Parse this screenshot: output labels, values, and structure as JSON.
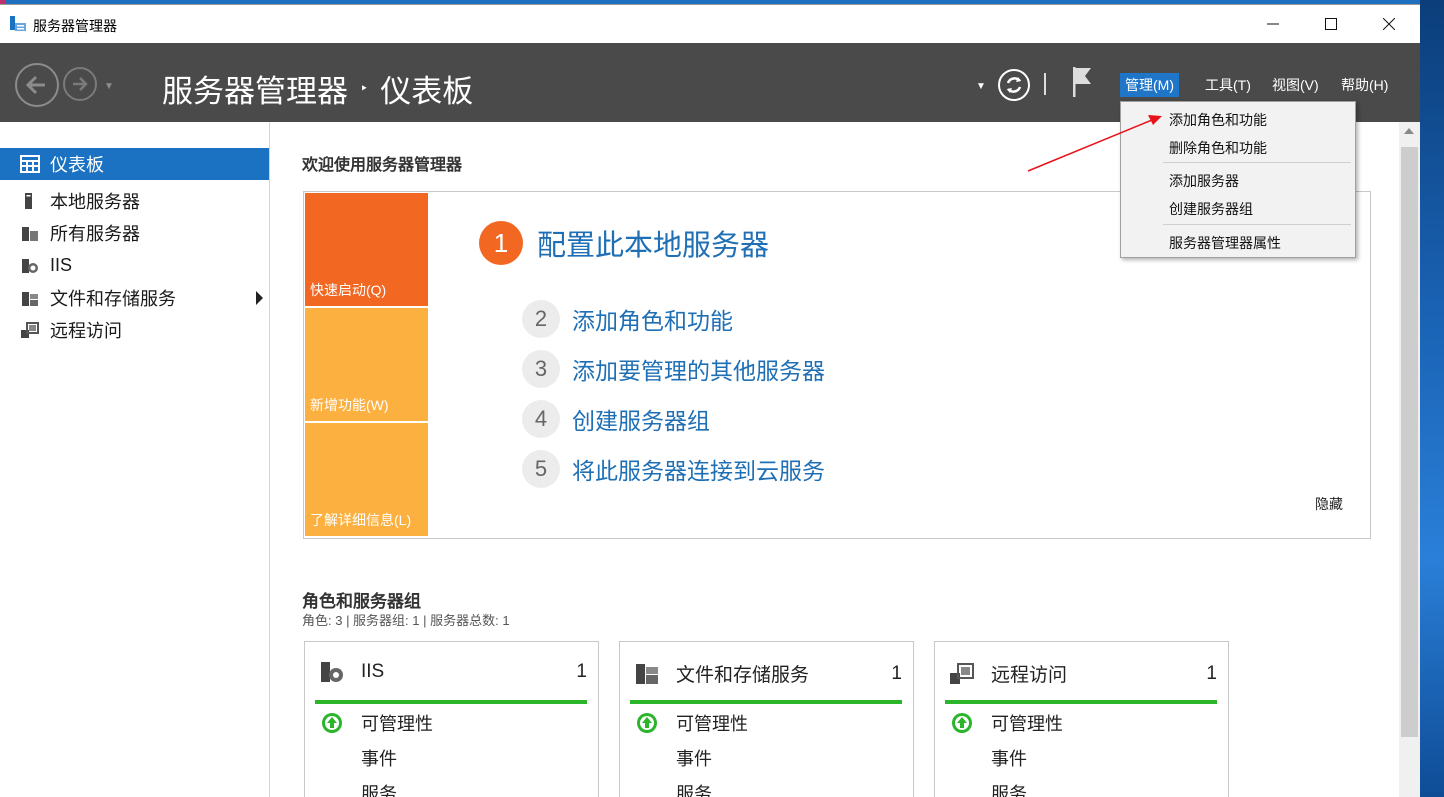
{
  "window": {
    "title": "服务器管理器"
  },
  "header": {
    "breadcrumb_root": "服务器管理器",
    "breadcrumb_separator": "‣",
    "breadcrumb_current": "仪表板"
  },
  "menu": {
    "manage": "管理(M)",
    "tools": "工具(T)",
    "view": "视图(V)",
    "help": "帮助(H)"
  },
  "manage_menu": {
    "items": [
      "添加角色和功能",
      "删除角色和功能",
      "添加服务器",
      "创建服务器组",
      "服务器管理器属性"
    ]
  },
  "sidebar": {
    "items": [
      {
        "label": "仪表板",
        "icon": "dashboard-icon"
      },
      {
        "label": "本地服务器",
        "icon": "server-icon"
      },
      {
        "label": "所有服务器",
        "icon": "servers-icon"
      },
      {
        "label": "IIS",
        "icon": "iis-icon"
      },
      {
        "label": "文件和存储服务",
        "icon": "file-storage-icon"
      },
      {
        "label": "远程访问",
        "icon": "remote-access-icon"
      }
    ]
  },
  "welcome": {
    "title": "欢迎使用服务器管理器",
    "tiles": {
      "quick_start": "快速启动(Q)",
      "whats_new": "新增功能(W)",
      "learn_more": "了解详细信息(L)"
    },
    "steps": [
      {
        "num": "1",
        "label": "配置此本地服务器"
      },
      {
        "num": "2",
        "label": "添加角色和功能"
      },
      {
        "num": "3",
        "label": "添加要管理的其他服务器"
      },
      {
        "num": "4",
        "label": "创建服务器组"
      },
      {
        "num": "5",
        "label": "将此服务器连接到云服务"
      }
    ],
    "hide": "隐藏"
  },
  "roles": {
    "title": "角色和服务器组",
    "summary": "角色: 3 | 服务器组: 1 | 服务器总数: 1",
    "cards": [
      {
        "name": "IIS",
        "count": "1",
        "rows": [
          "可管理性",
          "事件",
          "服务"
        ]
      },
      {
        "name": "文件和存储服务",
        "count": "1",
        "rows": [
          "可管理性",
          "事件",
          "服务"
        ]
      },
      {
        "name": "远程访问",
        "count": "1",
        "rows": [
          "可管理性",
          "事件",
          "服务"
        ]
      }
    ]
  },
  "colors": {
    "accent": "#1c72c2",
    "quick_start": "#f26722",
    "tile_secondary": "#fbb040",
    "status_ok": "#2ab52a",
    "command_bar": "#4a4a4a"
  }
}
